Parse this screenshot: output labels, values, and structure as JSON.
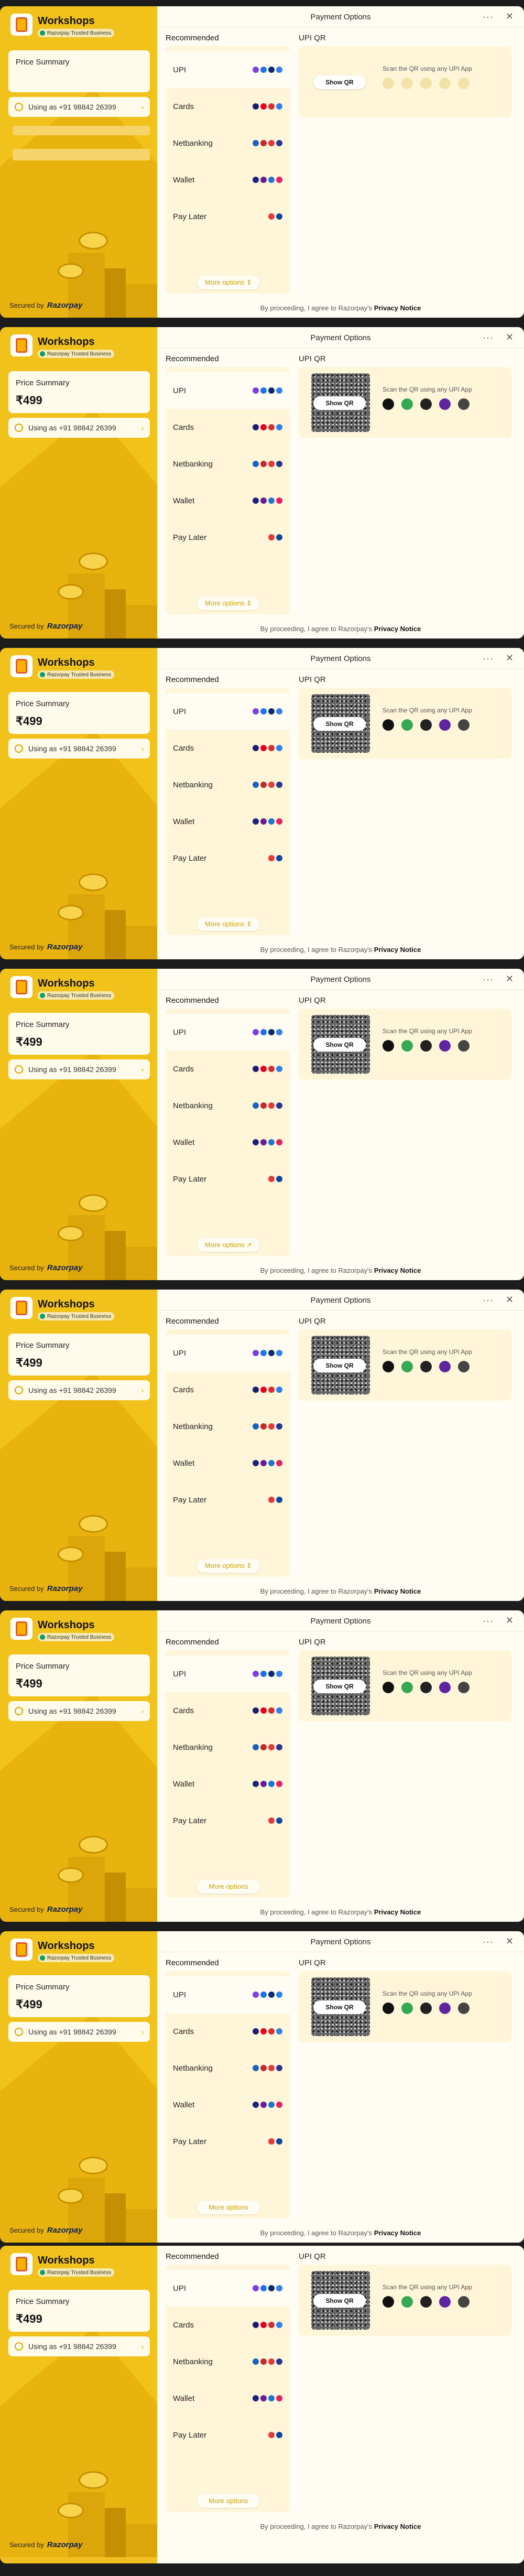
{
  "window": {
    "title": "Payment Options",
    "menu_icon": "more-dots-icon",
    "close_icon": "close-icon"
  },
  "merchant": {
    "name": "Workshops",
    "badge": "Razorpay Trusted Business"
  },
  "summary": {
    "label": "Price Summary",
    "amount": "₹499",
    "user": "Using as +91 98842 26399"
  },
  "footer": {
    "secured_label": "Secured by",
    "secured_brand": "Razorpay",
    "notice_prefix": "By proceeding, I agree to Razorpay's",
    "notice_link": "Privacy Notice"
  },
  "methods": {
    "section_label": "Recommended",
    "items": [
      {
        "label": "UPI",
        "icons": [
          "#7b3fe4",
          "#1a73e8",
          "#0b2a6f",
          "#2f80ed"
        ]
      },
      {
        "label": "Cards",
        "icons": [
          "#1a1f71",
          "#eb001b",
          "#d32f2f",
          "#2f80ed"
        ]
      },
      {
        "label": "Netbanking",
        "icons": [
          "#1565c0",
          "#c62828",
          "#e53935",
          "#283593"
        ]
      },
      {
        "label": "Wallet",
        "icons": [
          "#1a237e",
          "#6a1b9a",
          "#1976d2",
          "#e91e63"
        ]
      },
      {
        "label": "Pay Later",
        "icons": [
          "#e53935",
          "#0d47a1"
        ]
      }
    ],
    "more_label": "More options"
  },
  "qr": {
    "section_label": "UPI QR",
    "show_label": "Show QR",
    "scan_label": "Scan the QR using any UPI App",
    "app_colors": [
      "#111111",
      "#34a853",
      "#222222",
      "#5f259f",
      "#444444"
    ]
  },
  "frames": [
    {
      "amount_visible": false,
      "qr_visible": false,
      "apps_visible": false,
      "more_arrow": "⇕"
    },
    {
      "amount_visible": true,
      "qr_visible": true,
      "apps_visible": true,
      "more_arrow": "⇕"
    },
    {
      "amount_visible": true,
      "qr_visible": true,
      "apps_visible": true,
      "more_arrow": "⇕"
    },
    {
      "amount_visible": true,
      "qr_visible": true,
      "apps_visible": true,
      "more_arrow": "↗"
    },
    {
      "amount_visible": true,
      "qr_visible": true,
      "apps_visible": true,
      "more_arrow": "⇕"
    },
    {
      "amount_visible": true,
      "qr_visible": true,
      "apps_visible": true,
      "more_arrow": ""
    },
    {
      "amount_visible": true,
      "qr_visible": true,
      "apps_visible": true,
      "more_arrow": ""
    },
    {
      "amount_visible": true,
      "qr_visible": true,
      "apps_visible": true,
      "more_arrow": "",
      "no_header": true
    }
  ]
}
